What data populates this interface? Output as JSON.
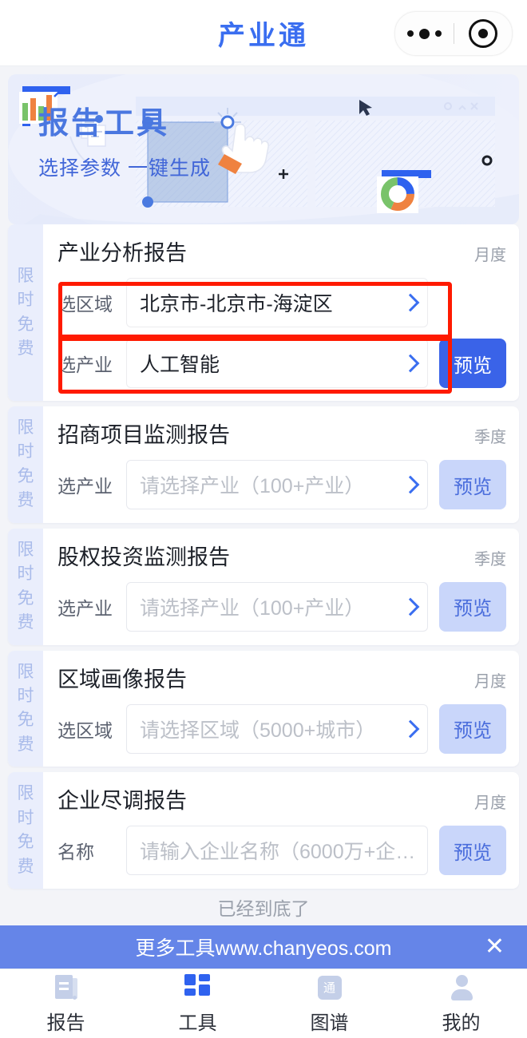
{
  "header": {
    "title": "产业通",
    "capsule": {
      "more_icon": "ellipsis-icon",
      "target_icon": "target-icon"
    }
  },
  "banner": {
    "title": "报告工具",
    "subtitle": "选择参数 一键生成",
    "illustration": "report-builder-illustration"
  },
  "cards": [
    {
      "tag": "限时免费",
      "title": "产业分析报告",
      "period": "月度",
      "rows": [
        {
          "label": "选区域",
          "value": "北京市-北京市-海淀区",
          "placeholder": "",
          "is_placeholder": false,
          "has_chevron": true,
          "highlighted": true
        },
        {
          "label": "选产业",
          "value": "人工智能",
          "placeholder": "",
          "is_placeholder": false,
          "has_chevron": true,
          "highlighted": true
        }
      ],
      "preview_label": "预览",
      "preview_state": "active"
    },
    {
      "tag": "限时免费",
      "title": "招商项目监测报告",
      "period": "季度",
      "rows": [
        {
          "label": "选产业",
          "value": "请选择产业（100+产业）",
          "placeholder": "请选择产业（100+产业）",
          "is_placeholder": true,
          "has_chevron": true,
          "highlighted": false
        }
      ],
      "preview_label": "预览",
      "preview_state": "disabled"
    },
    {
      "tag": "限时免费",
      "title": "股权投资监测报告",
      "period": "季度",
      "rows": [
        {
          "label": "选产业",
          "value": "请选择产业（100+产业）",
          "placeholder": "请选择产业（100+产业）",
          "is_placeholder": true,
          "has_chevron": true,
          "highlighted": false
        }
      ],
      "preview_label": "预览",
      "preview_state": "disabled"
    },
    {
      "tag": "限时免费",
      "title": "区域画像报告",
      "period": "月度",
      "rows": [
        {
          "label": "选区域",
          "value": "请选择区域（5000+城市）",
          "placeholder": "请选择区域（5000+城市）",
          "is_placeholder": true,
          "has_chevron": true,
          "highlighted": false
        }
      ],
      "preview_label": "预览",
      "preview_state": "disabled"
    },
    {
      "tag": "限时免费",
      "title": "企业尽调报告",
      "period": "月度",
      "rows": [
        {
          "label": "名称",
          "value": "请输入企业名称（6000万+企业）",
          "placeholder": "请输入企业名称（6000万+企业）",
          "is_placeholder": true,
          "has_chevron": false,
          "highlighted": false
        }
      ],
      "preview_label": "预览",
      "preview_state": "disabled"
    }
  ],
  "list_end_text": "已经到底了",
  "promo": {
    "text": "更多工具www.chanyeos.com",
    "close_icon": "close-icon"
  },
  "tabbar": [
    {
      "label": "报告",
      "icon": "report-icon",
      "active": false
    },
    {
      "label": "工具",
      "icon": "grid-icon",
      "active": true
    },
    {
      "label": "图谱",
      "icon": "graph-icon",
      "glyph": "通",
      "active": false
    },
    {
      "label": "我的",
      "icon": "person-icon",
      "active": false
    }
  ],
  "colors": {
    "brand_blue": "#3a6ef0",
    "button_active": "#3a63e8",
    "button_disabled": "#c9d6fa",
    "promo_bg": "#6585e8",
    "highlight_red": "#ff1a00",
    "page_bg": "#f3f4f8"
  }
}
